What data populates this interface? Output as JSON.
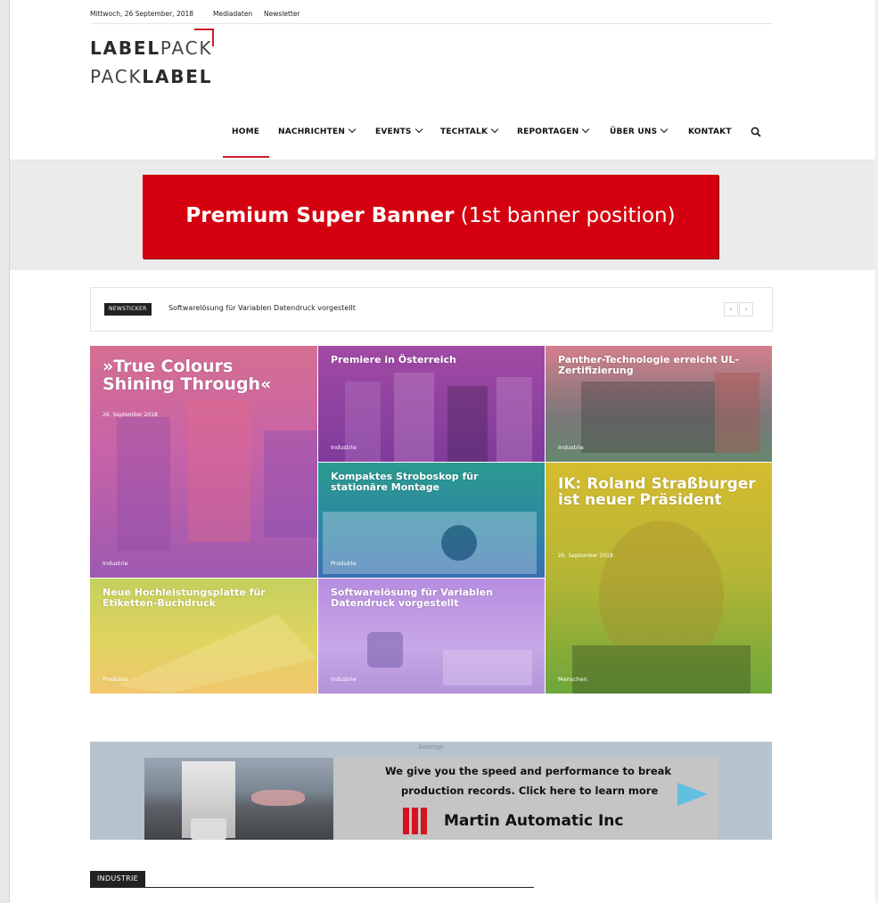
{
  "topbar": {
    "date": "Mittwoch, 26 September, 2018",
    "mediadaten": "Mediadaten",
    "newsletter": "Newsletter"
  },
  "logo": {
    "line1_bold": "LABEL",
    "line1_thin": "PACK",
    "line2_thin": "PACK",
    "line2_bold": "LABEL",
    "accent_color": "#d11c2a"
  },
  "nav": {
    "items": [
      {
        "label": "HOME",
        "active": true
      },
      {
        "label": "NACHRICHTEN",
        "dropdown": true
      },
      {
        "label": "EVENTS",
        "dropdown": true
      },
      {
        "label": "TECHTALK",
        "dropdown": true
      },
      {
        "label": "REPORTAGEN",
        "dropdown": true
      },
      {
        "label": "ÜBER UNS",
        "dropdown": true
      },
      {
        "label": "KONTAKT"
      }
    ],
    "search_icon": "search-icon"
  },
  "super_banner": {
    "bold": "Premium Super Banner",
    "rest": " (1st banner position)",
    "color": "#d5000f"
  },
  "ticker": {
    "label": "NEWSTICKER",
    "headline": "Softwarelösung für Variablen Datendruck vorgestellt",
    "prev_glyph": "‹",
    "next_glyph": "›"
  },
  "tiles": [
    {
      "title": "»True Colours Shining Through«",
      "date": "26. September 2018",
      "category": "Industrie"
    },
    {
      "title": "Premiere in Österreich",
      "category": "Industrie"
    },
    {
      "title": "Panther-Technologie erreicht UL-Zertifizierung",
      "category": "Industrie"
    },
    {
      "title": "Kompaktes Stroboskop für stationäre Montage",
      "category": "Produkte"
    },
    {
      "title": "IK: Roland Straßburger ist neuer Präsident",
      "date": "26. September 2018",
      "category": "Menschen"
    },
    {
      "title": "Neue Hochleistungsplatte für Etiketten-Buchdruck",
      "category": "Produkte"
    },
    {
      "title": "Softwarelösung für Variablen Datendruck vorgestellt",
      "category": "Industrie"
    }
  ],
  "ad": {
    "label": "Anzeige",
    "line1": "We give you the speed and performance to break",
    "line2": "production records.  Click here to learn more",
    "company": "Martin Automatic Inc",
    "background": "#b5c3ce"
  },
  "section": {
    "label": "INDUSTRIE"
  }
}
